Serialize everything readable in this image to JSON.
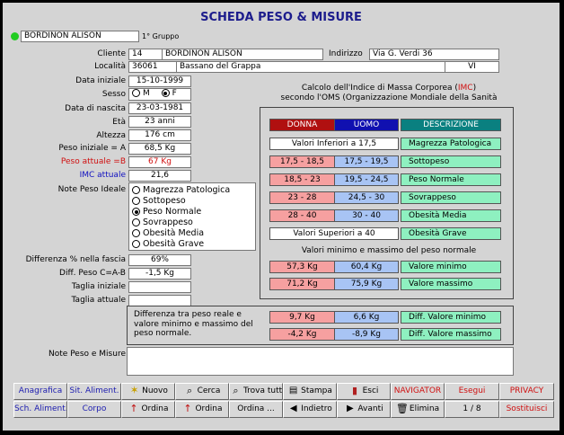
{
  "title": "SCHEDA PESO & MISURE",
  "header": {
    "name": "BORDINON ALISON",
    "group": "1° Gruppo",
    "status_color": "#22cc22"
  },
  "labels": {
    "cliente": "Cliente",
    "indirizzo": "Indirizzo",
    "localita": "Località",
    "data_iniziale": "Data iniziale",
    "sesso": "Sesso",
    "data_nascita": "Data di nascita",
    "eta": "Età",
    "altezza": "Altezza",
    "peso_iniziale": "Peso iniziale = A",
    "peso_attuale": "Peso attuale =B",
    "imc_attuale": "IMC attuale",
    "note_peso_ideale": "Note Peso Ideale",
    "differenza_perc": "Differenza % nella fascia",
    "diff_peso": "Diff. Peso C=A-B",
    "taglia_iniziale": "Taglia iniziale",
    "taglia_attuale": "Taglia attuale",
    "note_peso_misure": "Note Peso e Misure"
  },
  "values": {
    "cliente_id": "14",
    "cliente_nome": "BORDINON ALISON",
    "indirizzo": "Via G. Verdi 36",
    "cap": "36061",
    "citta": "Bassano del Grappa",
    "provincia": "VI",
    "data_iniziale": "15-10-1999",
    "sesso_m": "M",
    "sesso_f": "F",
    "data_nascita": "23-03-1981",
    "eta": "23 anni",
    "altezza": "176 cm",
    "peso_iniziale": "68,5 Kg",
    "peso_attuale": "67 Kg",
    "imc_attuale": "21,6",
    "differenza_perc": "69%",
    "diff_peso": "-1,5 Kg",
    "taglia_iniziale": "",
    "taglia_attuale": "",
    "note": ""
  },
  "note_options": [
    "Magrezza Patologica",
    "Sottopeso",
    "Peso Normale",
    "Sovrappeso",
    "Obesità Media",
    "Obesità Grave"
  ],
  "note_selected": 2,
  "imc": {
    "caption_pre": "Calcolo dell'Indice di Massa Corporea (",
    "caption_abbr": "IMC",
    "caption_post": ")",
    "caption2": "secondo l'OMS (Organizzazione Mondiale della Sanità",
    "headers": {
      "donna": "DONNA",
      "uomo": "UOMO",
      "descrizione": "DESCRIZIONE"
    },
    "rows": [
      {
        "donna": "Valori Inferiori a 17,5",
        "uomo": "",
        "descrizione": "Magrezza Patologica",
        "merged": true
      },
      {
        "donna": "17,5 - 18,5",
        "uomo": "17,5 - 19,5",
        "descrizione": "Sottopeso",
        "merged": false
      },
      {
        "donna": "18,5 - 23",
        "uomo": "19,5 - 24,5",
        "descrizione": "Peso Normale",
        "merged": false
      },
      {
        "donna": "23 - 28",
        "uomo": "24,5 - 30",
        "descrizione": "Sovrappeso",
        "merged": false
      },
      {
        "donna": "28 - 40",
        "uomo": "30 - 40",
        "descrizione": "Obesità Media",
        "merged": false
      },
      {
        "donna": "Valori Superiori a 40",
        "uomo": "",
        "descrizione": "Obesità Grave",
        "merged": true
      }
    ],
    "minmax_caption": "Valori minimo e massimo del peso normale",
    "minmax": [
      {
        "donna": "57,3 Kg",
        "uomo": "60,4 Kg",
        "descrizione": "Valore minimo"
      },
      {
        "donna": "71,2 Kg",
        "uomo": "75,9 Kg",
        "descrizione": "Valore massimo"
      }
    ]
  },
  "diff_panel": {
    "text": "Differenza tra peso reale e valore minimo e massimo del peso normale.",
    "rows": [
      {
        "donna": "9,7 Kg",
        "uomo": "6,6 Kg",
        "descrizione": "Diff. Valore minimo"
      },
      {
        "donna": "-4,2 Kg",
        "uomo": "-8,9 Kg",
        "descrizione": "Diff. Valore massimo"
      }
    ]
  },
  "toolbar": {
    "anagrafica": "Anagrafica",
    "sit_aliment": "Sit. Aliment.",
    "nuovo": "Nuovo",
    "cerca": "Cerca",
    "trova_tutti": "Trova tutti",
    "stampa": "Stampa",
    "esci": "Esci",
    "navigator": "NAVIGATOR",
    "esegui": "Esegui",
    "privacy": "PRIVACY",
    "sch_aliment": "Sch. Aliment.",
    "corpo": "Corpo",
    "ordina1": "Ordina",
    "ordina2": "Ordina",
    "ordina3": "Ordina ...",
    "indietro": "Indietro",
    "avanti": "Avanti",
    "elimina": "Elimina",
    "record": "1 / 8",
    "sostituisci": "Sostituisci"
  },
  "colors": {
    "donna_header": "#b01010",
    "uomo_header": "#1010b0",
    "descr_header": "#0a8080"
  }
}
